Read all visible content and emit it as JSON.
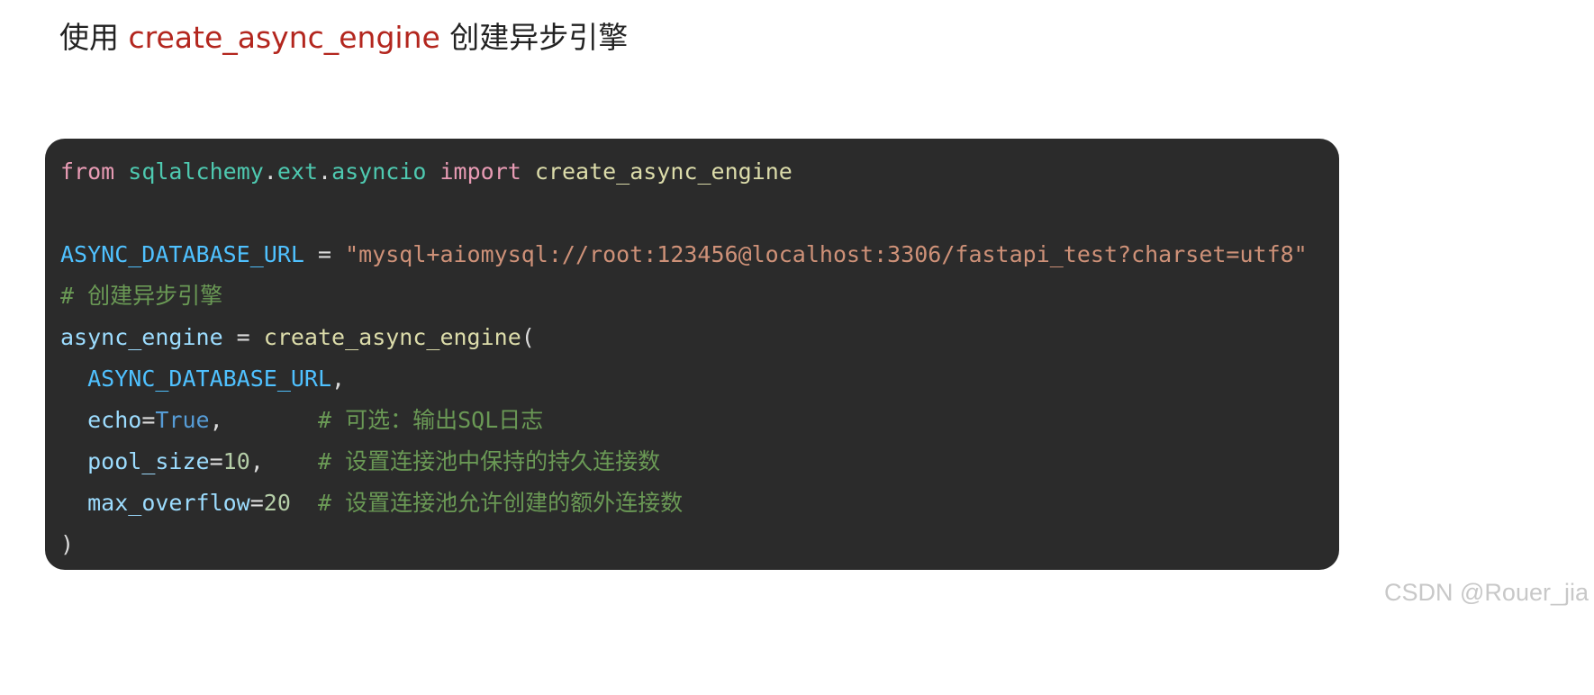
{
  "heading": {
    "prefix": "使用 ",
    "code": "create_async_engine",
    "suffix": " 创建异步引擎"
  },
  "code": {
    "line1": {
      "kw_from": "from",
      "mod1": "sqlalchemy",
      "dot1": ".",
      "mod2": "ext",
      "dot2": ".",
      "mod3": "asyncio",
      "kw_import": "import",
      "fn": "create_async_engine"
    },
    "line3": {
      "const": "ASYNC_DATABASE_URL",
      "eq": " = ",
      "str": "\"mysql+aiomysql://root:123456@localhost:3306/fastapi_test?charset=utf8\""
    },
    "line4": {
      "comment": "# 创建异步引擎"
    },
    "line5": {
      "var": "async_engine",
      "eq": " = ",
      "fn": "create_async_engine",
      "paren": "("
    },
    "line6": {
      "const": "ASYNC_DATABASE_URL",
      "comma": ","
    },
    "line7": {
      "param": "echo",
      "eq": "=",
      "value": "True",
      "comma": ",",
      "pad": "       ",
      "comment": "# 可选：输出SQL日志"
    },
    "line8": {
      "param": "pool_size",
      "eq": "=",
      "value": "10",
      "comma": ",",
      "pad": "    ",
      "comment": "# 设置连接池中保持的持久连接数"
    },
    "line9": {
      "param": "max_overflow",
      "eq": "=",
      "value": "20",
      "pad": "  ",
      "comment": "# 设置连接池允许创建的额外连接数"
    },
    "line10": {
      "paren": ")"
    }
  },
  "watermark": "CSDN @Rouer_jia",
  "colors": {
    "code_background": "#2b2b2b",
    "keyword": "#e89bb4",
    "module": "#4ec9b0",
    "function": "#dcdcaa",
    "constant": "#4fc1ff",
    "string": "#ce9178",
    "comment": "#6a9955",
    "inline_code": "#b3261e"
  }
}
